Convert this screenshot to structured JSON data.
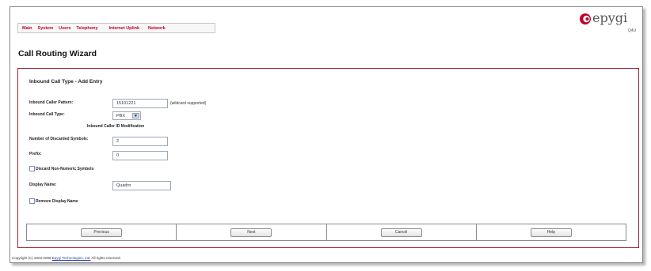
{
  "nav": {
    "items": [
      "Main",
      "System",
      "Users",
      "Telephony",
      "Internet Uplink",
      "Network"
    ]
  },
  "logo": {
    "text": "epygi",
    "subtext": "Q4U"
  },
  "page": {
    "title": "Call Routing Wizard"
  },
  "form": {
    "section_title": "Inbound Call Type - Add Entry",
    "caller_pattern": {
      "label": "Inbound Caller Pattern:",
      "value": "15101221",
      "note": "(wildcard supported)"
    },
    "call_type": {
      "label": "Inbound Call Type:",
      "value": "PBX"
    },
    "modification_heading": "Inbound Caller ID Modification",
    "discarded_symbols": {
      "label": "Number of Discarded Symbols:",
      "value": "2"
    },
    "prefix": {
      "label": "Prefix:",
      "value": "0"
    },
    "discard_non_numeric": {
      "label": "Discard Non-Numeric Symbols",
      "checked": false
    },
    "display_name": {
      "label": "Display Name:",
      "value": "Quadro"
    },
    "remove_display_name": {
      "label": "Remove Display Name",
      "checked": false
    }
  },
  "buttons": {
    "previous": "Previous",
    "next": "Next",
    "cancel": "Cancel",
    "help": "Help"
  },
  "footer": {
    "copyright_prefix": "Copyright (C) 2003-2006 ",
    "company_link": "Epygi Technologies, Ltd.",
    "copyright_suffix": " All rights reserved."
  },
  "colors": {
    "accent": "#c0002a",
    "border": "#a02030"
  }
}
